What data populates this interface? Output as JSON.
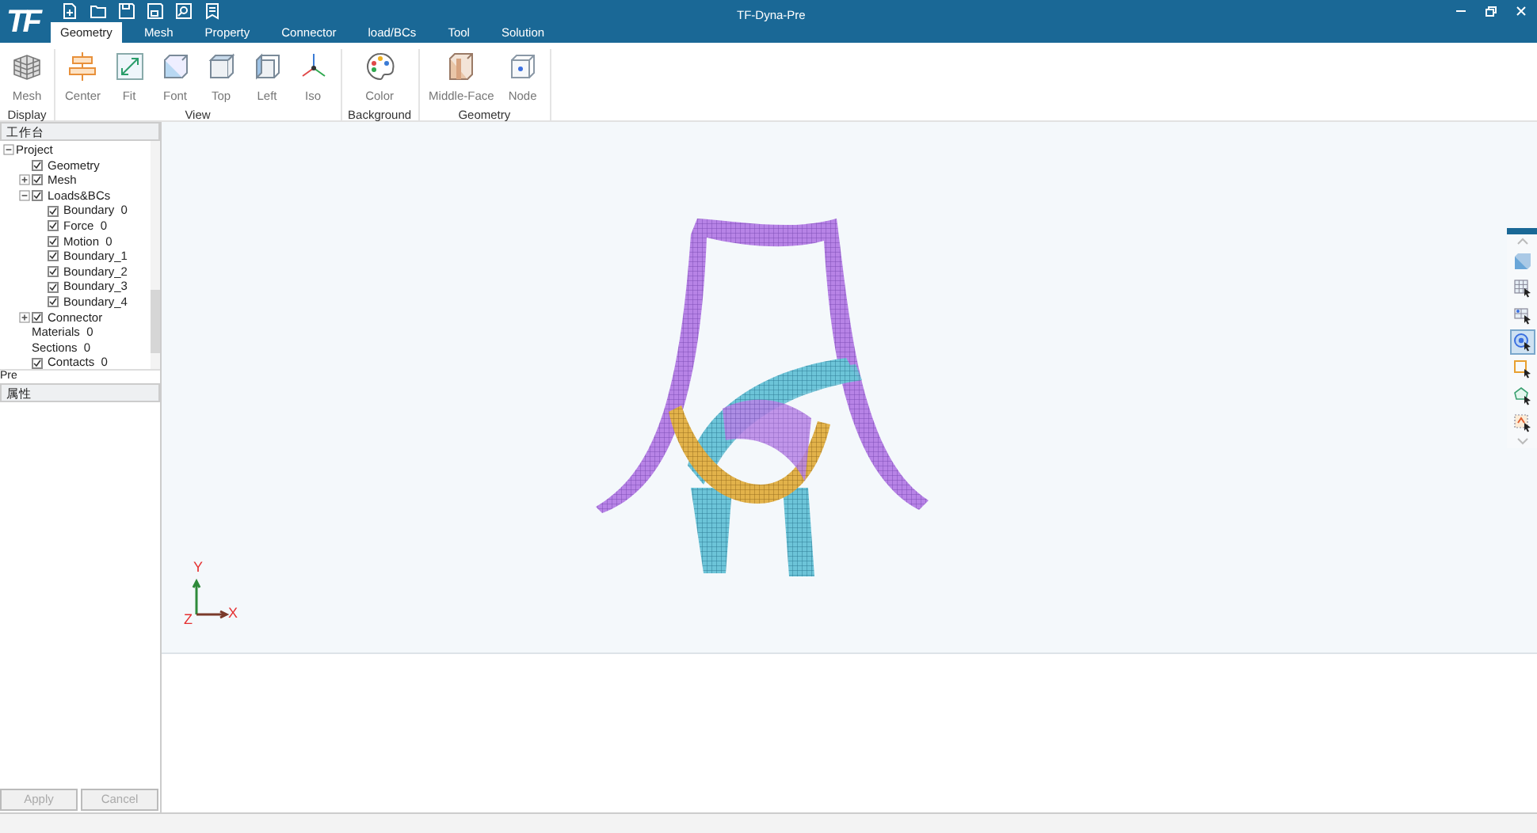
{
  "window": {
    "logo": "TF",
    "title": "TF-Dyna-Pre"
  },
  "tabs": [
    {
      "label": "Geometry",
      "selected": true
    },
    {
      "label": "Mesh",
      "selected": false
    },
    {
      "label": "Property",
      "selected": false
    },
    {
      "label": "Connector",
      "selected": false
    },
    {
      "label": "load/BCs",
      "selected": false
    },
    {
      "label": "Tool",
      "selected": false
    },
    {
      "label": "Solution",
      "selected": false
    }
  ],
  "ribbon": [
    {
      "group": "Display",
      "items": [
        {
          "label": "Mesh"
        }
      ]
    },
    {
      "group": "View",
      "items": [
        {
          "label": "Center"
        },
        {
          "label": "Fit"
        },
        {
          "label": "Font"
        },
        {
          "label": "Top"
        },
        {
          "label": "Left"
        },
        {
          "label": "Iso"
        }
      ]
    },
    {
      "group": "Background",
      "items": [
        {
          "label": "Color"
        }
      ]
    },
    {
      "group": "Geometry",
      "items": [
        {
          "label": "Middle-Face"
        },
        {
          "label": "Node"
        }
      ]
    }
  ],
  "workbench": {
    "title": "工作台",
    "tree": [
      {
        "label": "Project",
        "kind": "label",
        "expanded": true,
        "children": [
          {
            "label": "Geometry",
            "kind": "checkbox",
            "checked": true
          },
          {
            "label": "Mesh",
            "kind": "checkbox",
            "checked": true,
            "expanded": false
          },
          {
            "label": "Loads&BCs",
            "kind": "checkbox",
            "checked": true,
            "expanded": true,
            "children": [
              {
                "label": "Boundary  0",
                "kind": "checkbox",
                "checked": true
              },
              {
                "label": "Force  0",
                "kind": "checkbox",
                "checked": true
              },
              {
                "label": "Motion  0",
                "kind": "checkbox",
                "checked": true
              },
              {
                "label": "Boundary_1",
                "kind": "checkbox",
                "checked": true
              },
              {
                "label": "Boundary_2",
                "kind": "checkbox",
                "checked": true
              },
              {
                "label": "Boundary_3",
                "kind": "checkbox",
                "checked": true
              },
              {
                "label": "Boundary_4",
                "kind": "checkbox",
                "checked": true
              }
            ]
          },
          {
            "label": "Connector",
            "kind": "checkbox",
            "checked": true,
            "expanded": false
          },
          {
            "label": "Materials  0",
            "kind": "label"
          },
          {
            "label": "Sections  0",
            "kind": "label"
          },
          {
            "label": "Contacts  0",
            "kind": "checkbox",
            "checked": true
          }
        ]
      }
    ],
    "footer": "Pre"
  },
  "properties": {
    "title": "属性",
    "buttons": [
      {
        "label": "Apply",
        "disabled": true
      },
      {
        "label": "Cancel",
        "disabled": true
      }
    ]
  },
  "viewport": {
    "axes": {
      "y": "Y",
      "x": "X",
      "z": "Z"
    }
  },
  "view_tools": [
    {
      "selected": false
    },
    {
      "selected": false
    },
    {
      "selected": false
    },
    {
      "selected": true
    },
    {
      "selected": false
    },
    {
      "selected": false
    },
    {
      "selected": false
    }
  ]
}
